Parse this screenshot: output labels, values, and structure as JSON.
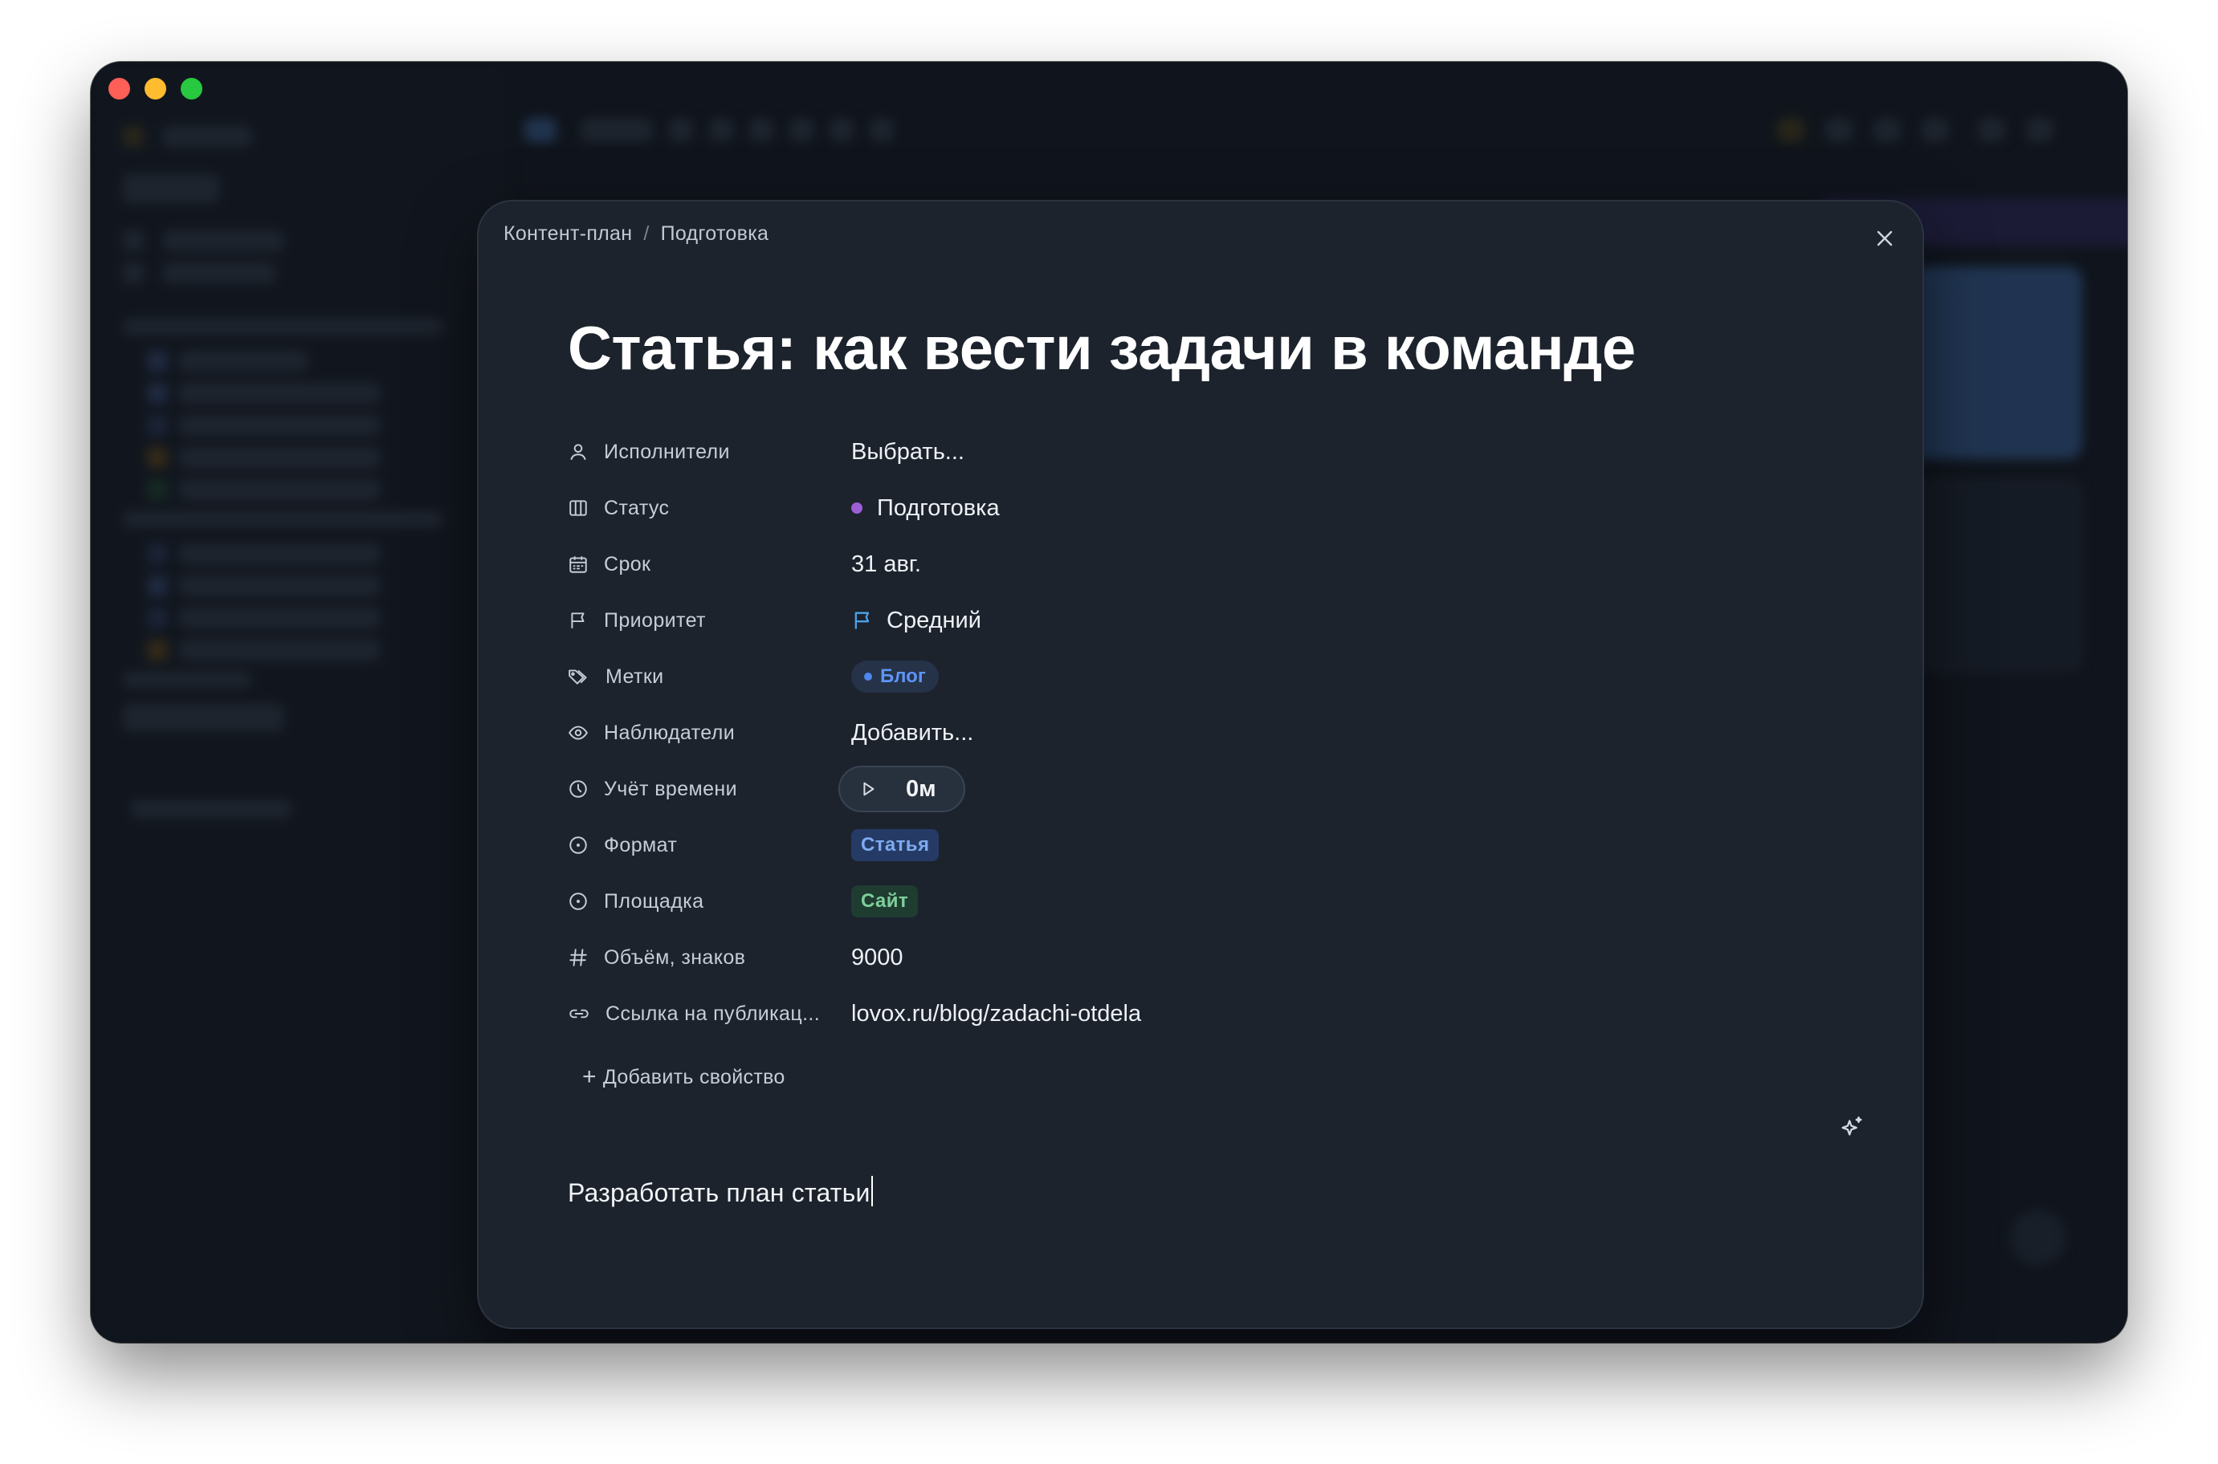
{
  "window": {
    "traffic_lights": [
      "close",
      "minimize",
      "maximize"
    ]
  },
  "modal": {
    "breadcrumb": [
      "Контент-план",
      "Подготовка"
    ],
    "breadcrumb_separator": "/",
    "title": "Статья: как вести задачи в команде",
    "properties": {
      "assignees": {
        "label": "Исполнители",
        "value": "Выбрать...",
        "icon": "user-icon"
      },
      "status": {
        "label": "Статус",
        "value": "Подготовка",
        "color": "#9c5fd6",
        "icon": "columns-icon"
      },
      "due": {
        "label": "Срок",
        "value": "31 авг.",
        "icon": "calendar-icon"
      },
      "priority": {
        "label": "Приоритет",
        "value": "Средний",
        "color": "#4aa3e6",
        "icon": "flag-icon"
      },
      "tags": {
        "label": "Метки",
        "value": "Блог",
        "color": "#4f86ef",
        "icon": "tags-icon"
      },
      "watchers": {
        "label": "Наблюдатели",
        "value": "Добавить...",
        "icon": "eye-icon"
      },
      "time_tracking": {
        "label": "Учёт времени",
        "value": "0м",
        "icon": "clock-icon"
      },
      "format": {
        "label": "Формат",
        "value": "Статья",
        "icon": "circle-dot-icon"
      },
      "platform": {
        "label": "Площадка",
        "value": "Сайт",
        "icon": "circle-dot-icon"
      },
      "length": {
        "label": "Объём, знаков",
        "value": "9000",
        "icon": "hash-icon"
      },
      "link": {
        "label": "Ссылка на публикац...",
        "value": "lovox.ru/blog/zadachi-otdela",
        "icon": "link-icon"
      }
    },
    "add_property_label": "Добавить свойство",
    "description": "Разработать план статьи"
  },
  "colors": {
    "modal_bg": "#1c232d",
    "window_bg": "#141a22",
    "status_purple": "#9c5fd6",
    "tag_blue": "#5d95f5",
    "site_green": "#7ecf9a"
  }
}
